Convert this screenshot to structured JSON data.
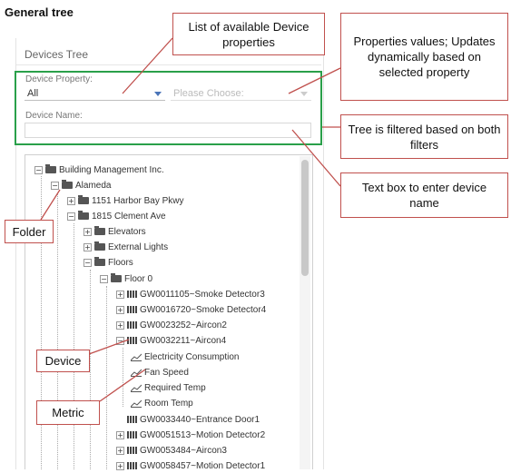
{
  "heading": "General tree",
  "panel": {
    "title": "Devices Tree",
    "device_property_label": "Device Property:",
    "device_property_value": "All",
    "property_value_placeholder": "Please Choose:",
    "device_name_label": "Device Name:",
    "device_name_value": ""
  },
  "tree": {
    "root": "Building Management Inc.",
    "site": "Alameda",
    "building1": "1151 Harbor Bay Pkwy",
    "building2": "1815 Clement Ave",
    "elevators": "Elevators",
    "external_lights": "External Lights",
    "floors": "Floors",
    "floor0": "Floor 0",
    "devices": [
      "GW0011105~Smoke Detector3",
      "GW0016720~Smoke Detector4",
      "GW0023252~Aircon2",
      "GW0032211~Aircon4"
    ],
    "metrics": [
      "Electricity Consumption",
      "Fan Speed",
      "Required Temp",
      "Room Temp"
    ],
    "devices_after": [
      "GW0033440~Entrance Door1",
      "GW0051513~Motion Detector2",
      "GW0053484~Aircon3",
      "GW0058457~Motion Detector1"
    ]
  },
  "annotations": {
    "list_props": "List of available Device properties",
    "prop_values": "Properties values; Updates dynamically based on selected property",
    "tree_filtered": "Tree is filtered based on both filters",
    "text_box": "Text box to enter device name",
    "folder": "Folder",
    "device": "Device",
    "metric": "Metric"
  },
  "colors": {
    "annotation_border": "#c0504d",
    "filter_box": "#2aa04a",
    "dropdown_caret": "#4a74b8"
  }
}
